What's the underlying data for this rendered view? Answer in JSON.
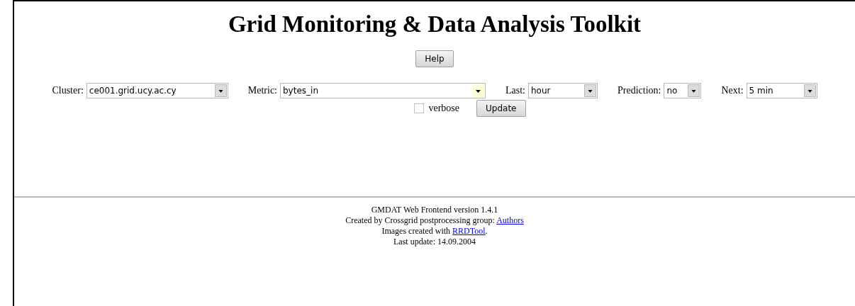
{
  "title": "Grid Monitoring & Data Analysis Toolkit",
  "help_button": "Help",
  "selectors": [
    {
      "label": "Cluster:",
      "value": "ce001.grid.ucy.ac.cy",
      "highlighted": false
    },
    {
      "label": "Metric:",
      "value": "bytes_in",
      "highlighted": true
    },
    {
      "label": "Last:",
      "value": "hour",
      "highlighted": false
    },
    {
      "label": "Prediction:",
      "value": "no",
      "highlighted": false
    },
    {
      "label": "Next:",
      "value": "5 min",
      "highlighted": false
    }
  ],
  "verbose": {
    "label": "verbose",
    "checked": false
  },
  "update_button": "Update",
  "footer": [
    {
      "text": "GMDAT Web Frontend version 1.4.1"
    },
    {
      "text": "Created by Crossgrid postprocessing group: ",
      "link": "Authors"
    },
    {
      "text": "Images created with ",
      "link": "RRDTool",
      "after": "."
    },
    {
      "text": "Last update: 14.09.2004"
    }
  ]
}
